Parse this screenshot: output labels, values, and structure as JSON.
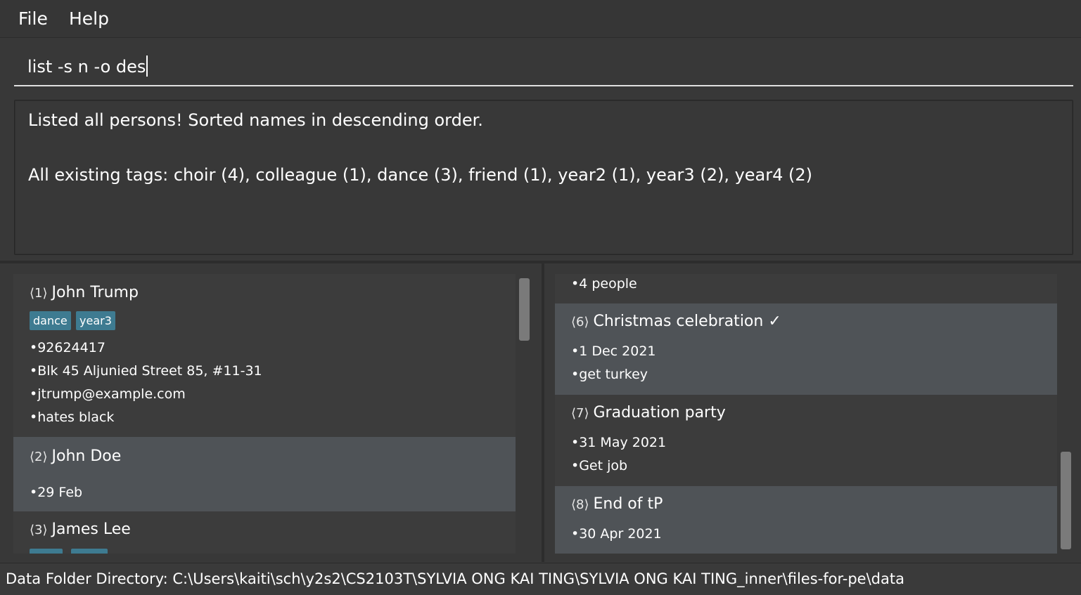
{
  "menu": {
    "file": "File",
    "help": "Help"
  },
  "command": {
    "value": "list -s n -o des"
  },
  "result": {
    "line1": "Listed all persons! Sorted names in descending order.",
    "line2": "All existing tags: choir (4), colleague (1), dance (3), friend (1), year2 (1), year3 (2), year4 (2)"
  },
  "persons": [
    {
      "index": "⟨1⟩",
      "name": "John Trump",
      "tags": [
        "dance",
        "year3"
      ],
      "phone": "•92624417",
      "address": "•Blk 45 Aljunied Street 85, #11-31",
      "email": "•jtrump@example.com",
      "remark": "•hates black"
    },
    {
      "index": "⟨2⟩",
      "name": "John Doe",
      "date": "•29 Feb"
    },
    {
      "index": "⟨3⟩",
      "name": "James Lee"
    }
  ],
  "events": {
    "partial_line": "•4 people",
    "items": [
      {
        "index": "⟨6⟩",
        "name": "Christmas celebration",
        "done": "✓",
        "date": "•1 Dec 2021",
        "desc": "•get turkey"
      },
      {
        "index": "⟨7⟩",
        "name": "Graduation party",
        "date": "•31 May 2021",
        "desc": "•Get job"
      },
      {
        "index": "⟨8⟩",
        "name": "End of tP",
        "date": "•30 Apr 2021"
      }
    ]
  },
  "status": {
    "path": "Data Folder Directory: C:\\Users\\kaiti\\sch\\y2s2\\CS2103T\\SYLVIA ONG KAI TING\\SYLVIA ONG KAI TING_inner\\files-for-pe\\data"
  },
  "colors": {
    "tag_bg": "#3e7b91",
    "card_selected": "#4f5357",
    "background": "#383838"
  }
}
